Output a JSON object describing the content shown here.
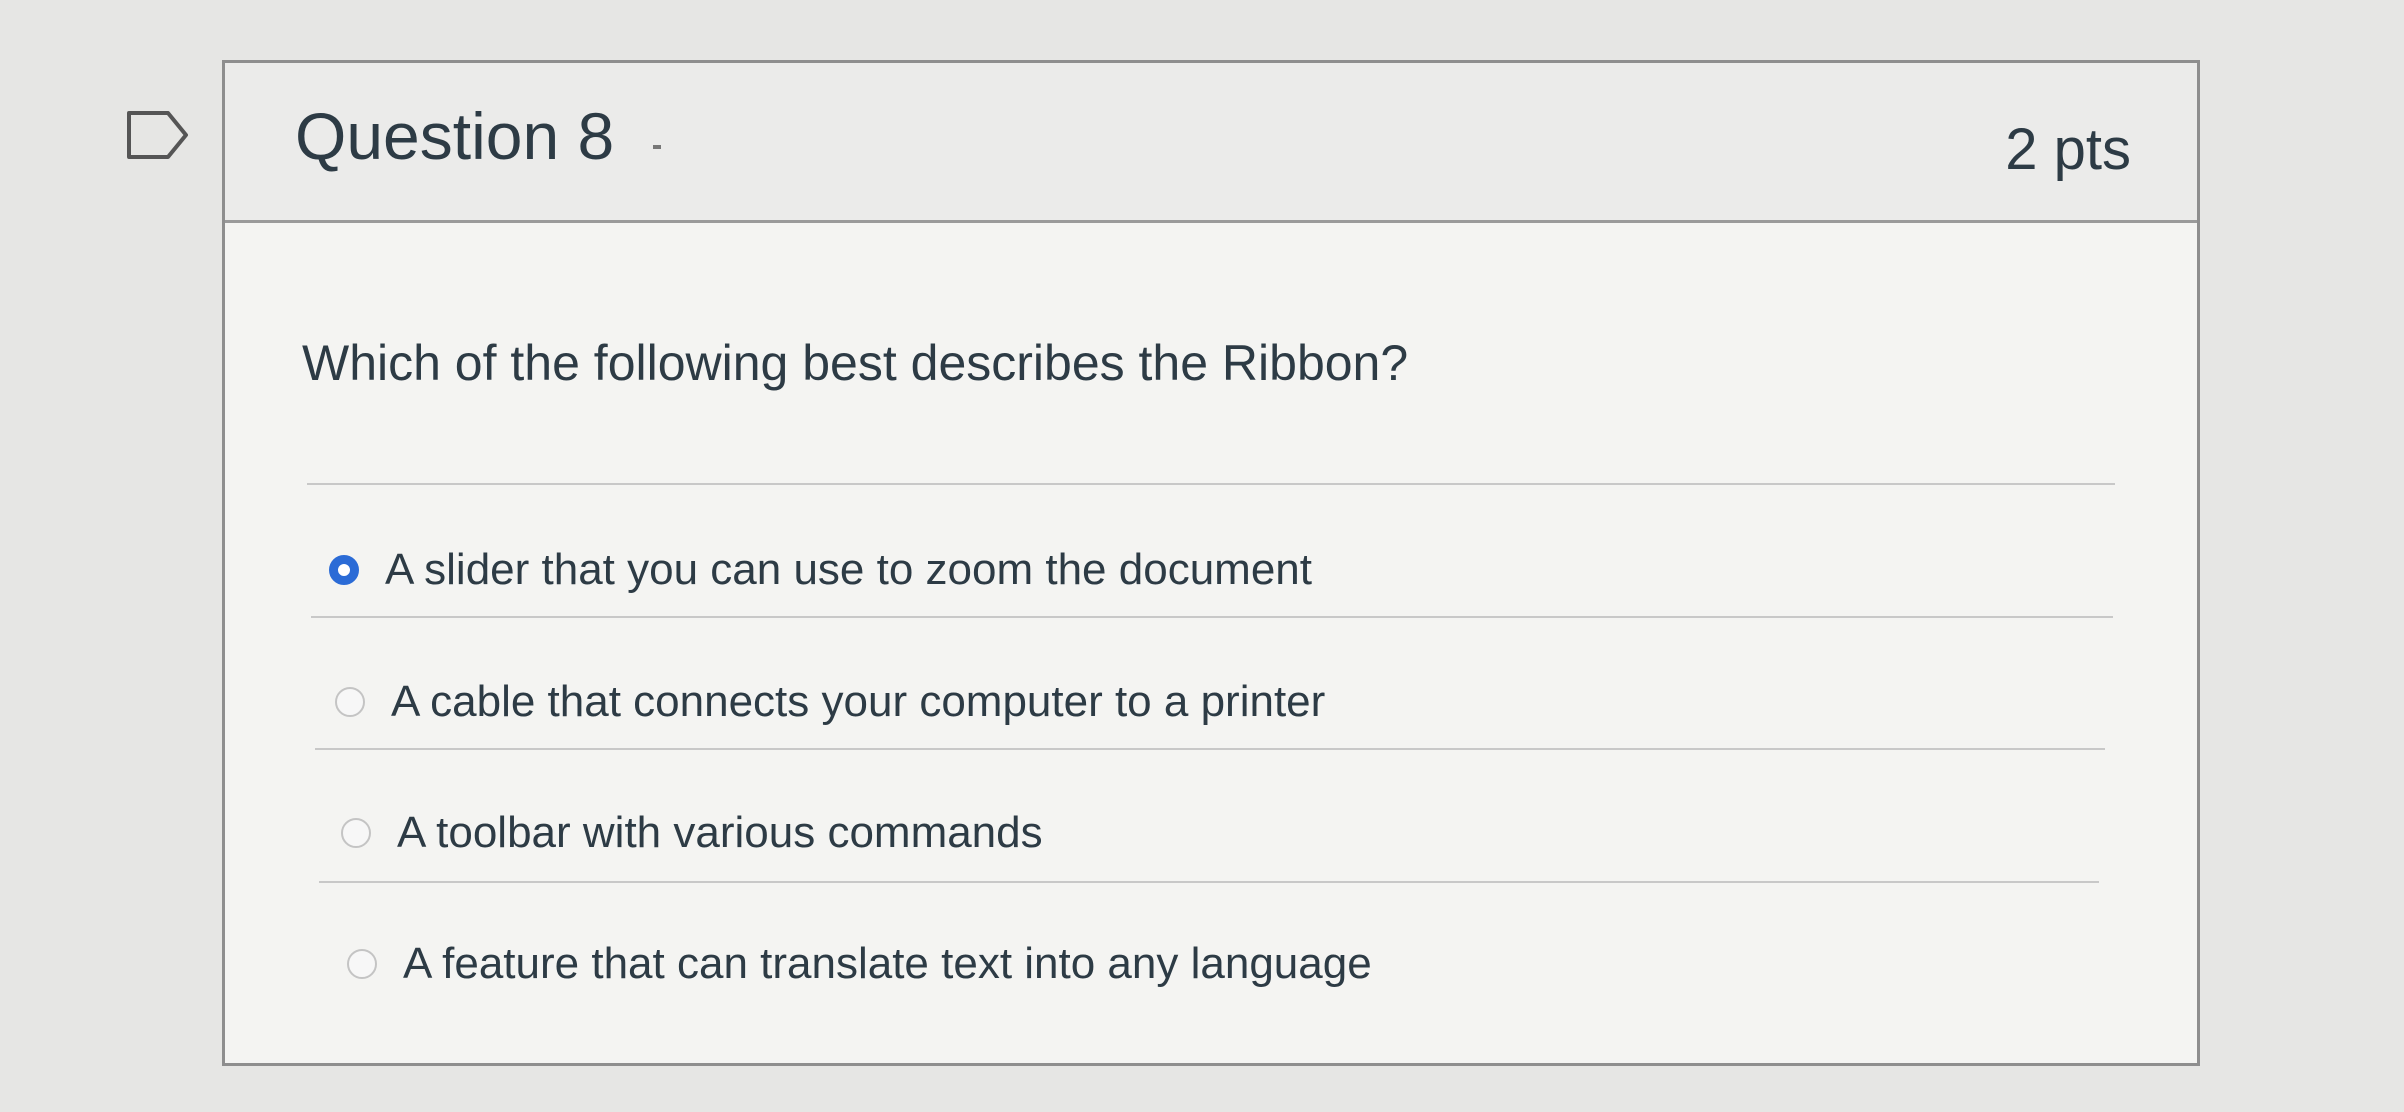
{
  "question": {
    "title": "Question 8",
    "points": "2 pts",
    "prompt": "Which of the following best describes the Ribbon?",
    "flag_icon": "bookmark-flag-icon",
    "accent_color": "#2b6bd6",
    "answers": [
      {
        "label": "A slider that you can use to zoom the document",
        "selected": true
      },
      {
        "label": "A cable that connects your computer to a printer",
        "selected": false
      },
      {
        "label": "A toolbar with various commands",
        "selected": false
      },
      {
        "label": "A feature that can translate text into any language",
        "selected": false
      }
    ]
  }
}
